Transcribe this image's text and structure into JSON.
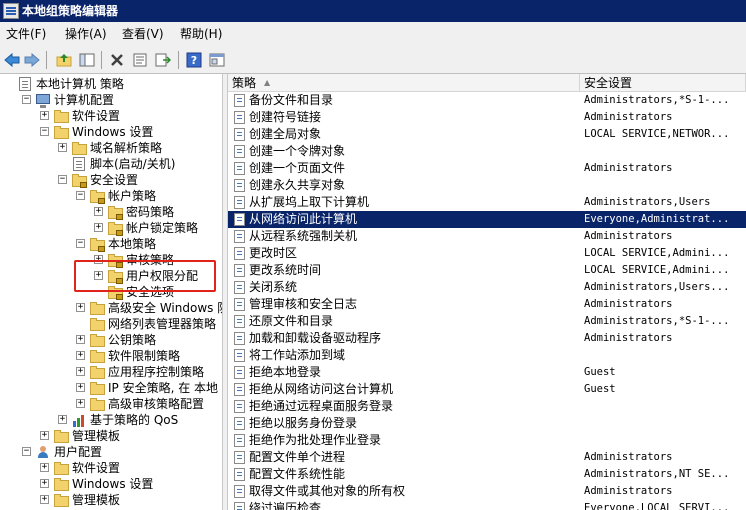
{
  "window": {
    "title": "本地组策略编辑器"
  },
  "menu": [
    "文件(F)",
    "操作(A)",
    "查看(V)",
    "帮助(H)"
  ],
  "toolbar": {
    "buttons": [
      "back-arrow-icon",
      "forward-arrow-icon",
      "up-folder-icon",
      "show-hide-tree-icon",
      "delete-icon",
      "properties-icon",
      "export-list-icon",
      "help-icon",
      "console-icon"
    ]
  },
  "tree": [
    {
      "label": "本地计算机 策略",
      "depth": 0,
      "exp": "",
      "icon": "doc"
    },
    {
      "label": "计算机配置",
      "depth": 1,
      "exp": "−",
      "icon": "computer"
    },
    {
      "label": "软件设置",
      "depth": 2,
      "exp": "+",
      "icon": "folder"
    },
    {
      "label": "Windows 设置",
      "depth": 2,
      "exp": "−",
      "icon": "folder"
    },
    {
      "label": "域名解析策略",
      "depth": 3,
      "exp": "+",
      "icon": "folder"
    },
    {
      "label": "脚本(启动/关机)",
      "depth": 3,
      "exp": "",
      "icon": "doc"
    },
    {
      "label": "安全设置",
      "depth": 3,
      "exp": "−",
      "icon": "folder-lock"
    },
    {
      "label": "帐户策略",
      "depth": 4,
      "exp": "−",
      "icon": "folder-lock"
    },
    {
      "label": "密码策略",
      "depth": 5,
      "exp": "+",
      "icon": "folder-lock"
    },
    {
      "label": "帐户锁定策略",
      "depth": 5,
      "exp": "+",
      "icon": "folder-lock"
    },
    {
      "label": "本地策略",
      "depth": 4,
      "exp": "−",
      "icon": "folder-lock"
    },
    {
      "label": "审核策略",
      "depth": 5,
      "exp": "+",
      "icon": "folder-lock"
    },
    {
      "label": "用户权限分配",
      "depth": 5,
      "exp": "+",
      "icon": "folder-lock"
    },
    {
      "label": "安全选项",
      "depth": 5,
      "exp": "",
      "icon": "folder-lock"
    },
    {
      "label": "高级安全 Windows 防火",
      "depth": 4,
      "exp": "+",
      "icon": "folder"
    },
    {
      "label": "网络列表管理器策略",
      "depth": 4,
      "exp": "",
      "icon": "folder"
    },
    {
      "label": "公钥策略",
      "depth": 4,
      "exp": "+",
      "icon": "folder"
    },
    {
      "label": "软件限制策略",
      "depth": 4,
      "exp": "+",
      "icon": "folder"
    },
    {
      "label": "应用程序控制策略",
      "depth": 4,
      "exp": "+",
      "icon": "folder"
    },
    {
      "label": "IP 安全策略, 在 本地",
      "depth": 4,
      "exp": "+",
      "icon": "folder"
    },
    {
      "label": "高级审核策略配置",
      "depth": 4,
      "exp": "+",
      "icon": "folder"
    },
    {
      "label": "基于策略的 QoS",
      "depth": 3,
      "exp": "+",
      "icon": "bars"
    },
    {
      "label": "管理模板",
      "depth": 2,
      "exp": "+",
      "icon": "folder"
    },
    {
      "label": "用户配置",
      "depth": 1,
      "exp": "−",
      "icon": "users"
    },
    {
      "label": "软件设置",
      "depth": 2,
      "exp": "+",
      "icon": "folder"
    },
    {
      "label": "Windows 设置",
      "depth": 2,
      "exp": "+",
      "icon": "folder"
    },
    {
      "label": "管理模板",
      "depth": 2,
      "exp": "+",
      "icon": "folder"
    }
  ],
  "list": {
    "columns": [
      "策略",
      "安全设置"
    ],
    "sort_indicator": "▲",
    "rows": [
      {
        "policy": "备份文件和目录",
        "setting": "Administrators,*S-1-..."
      },
      {
        "policy": "创建符号链接",
        "setting": "Administrators"
      },
      {
        "policy": "创建全局对象",
        "setting": "LOCAL SERVICE,NETWOR..."
      },
      {
        "policy": "创建一个令牌对象",
        "setting": ""
      },
      {
        "policy": "创建一个页面文件",
        "setting": "Administrators"
      },
      {
        "policy": "创建永久共享对象",
        "setting": ""
      },
      {
        "policy": "从扩展坞上取下计算机",
        "setting": "Administrators,Users"
      },
      {
        "policy": "从网络访问此计算机",
        "setting": "Everyone,Administrat...",
        "selected": true
      },
      {
        "policy": "从远程系统强制关机",
        "setting": "Administrators"
      },
      {
        "policy": "更改时区",
        "setting": "LOCAL SERVICE,Admini..."
      },
      {
        "policy": "更改系统时间",
        "setting": "LOCAL SERVICE,Admini..."
      },
      {
        "policy": "关闭系统",
        "setting": "Administrators,Users..."
      },
      {
        "policy": "管理审核和安全日志",
        "setting": "Administrators"
      },
      {
        "policy": "还原文件和目录",
        "setting": "Administrators,*S-1-..."
      },
      {
        "policy": "加载和卸载设备驱动程序",
        "setting": "Administrators"
      },
      {
        "policy": "将工作站添加到域",
        "setting": ""
      },
      {
        "policy": "拒绝本地登录",
        "setting": "Guest"
      },
      {
        "policy": "拒绝从网络访问这台计算机",
        "setting": "Guest"
      },
      {
        "policy": "拒绝通过远程桌面服务登录",
        "setting": ""
      },
      {
        "policy": "拒绝以服务身份登录",
        "setting": ""
      },
      {
        "policy": "拒绝作为批处理作业登录",
        "setting": ""
      },
      {
        "policy": "配置文件单个进程",
        "setting": "Administrators"
      },
      {
        "policy": "配置文件系统性能",
        "setting": "Administrators,NT SE..."
      },
      {
        "policy": "取得文件或其他对象的所有权",
        "setting": "Administrators"
      },
      {
        "policy": "绕过遍历检查",
        "setting": "Everyone,LOCAL SERVI..."
      }
    ]
  },
  "colors": {
    "selection": "#0a246a",
    "titlebar": "#0a246a",
    "highlight_box": "#e0241c"
  }
}
